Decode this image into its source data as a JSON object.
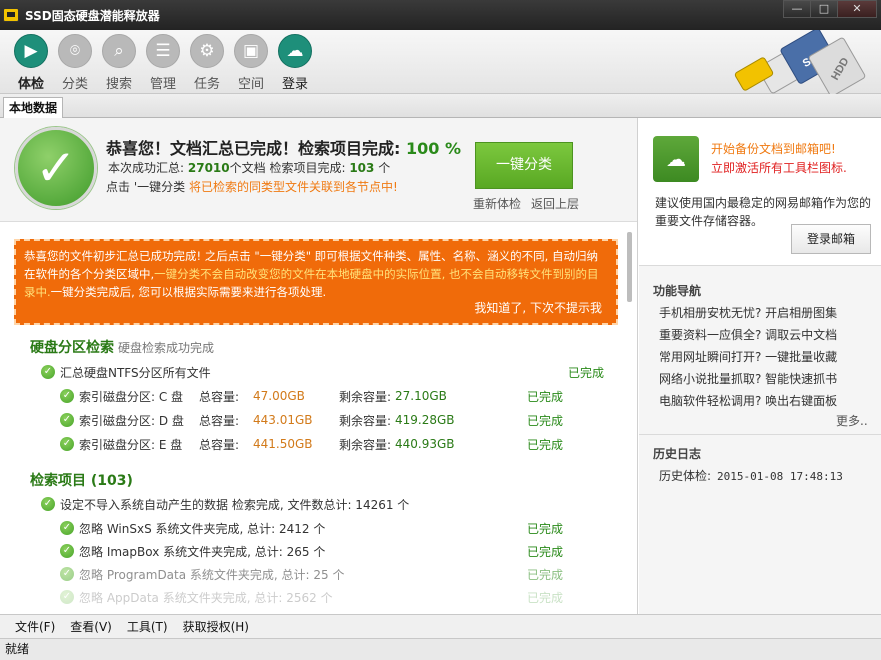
{
  "window": {
    "title": "SSD固态硬盘潜能释放器",
    "buttons": [
      "—",
      "□",
      "✕"
    ]
  },
  "toolbar": {
    "items": [
      {
        "label": "体检",
        "icon": "play-icon",
        "glyph": "▶"
      },
      {
        "label": "分类",
        "icon": "location-icon",
        "glyph": "⌾"
      },
      {
        "label": "搜索",
        "icon": "search-icon",
        "glyph": "⌕"
      },
      {
        "label": "管理",
        "icon": "list-icon",
        "glyph": "☰"
      },
      {
        "label": "任务",
        "icon": "gear-icon",
        "glyph": "⚙"
      },
      {
        "label": "空间",
        "icon": "id-card-icon",
        "glyph": "▣"
      },
      {
        "label": "登录",
        "icon": "cloud-icon",
        "glyph": "☁"
      }
    ],
    "brand": {
      "ssd_text": "SSD",
      "hdd_text": "HDD"
    }
  },
  "tabs": [
    "本地数据"
  ],
  "summary": {
    "title": "恭喜您！文档汇总已完成！检索项目完成:",
    "percent": "100 %",
    "line1_prefix": "本次成功汇总:",
    "doc_count": "27010",
    "line1_mid": "个文档  检索项目完成:",
    "item_count": "103",
    "line1_suffix": "个",
    "line2_prefix": "点击 '一键分类",
    "line2_hint": "将已检索的同类型文件关联到各节点中!",
    "classify_button": "一键分类",
    "recheck_link": "重新体检",
    "back_link": "返回上层"
  },
  "notice": {
    "text1": "恭喜您的文件初步汇总已成功完成! 之后点击 \"一键分类\" 即可根据文件种类、属性、名称、涵义的不同, 自动归纳在软件的各个分类区域中,",
    "text2": "一键分类不会自动改变您的文件在本地硬盘中的实际位置, 也不会自动移转文件到别的目录中.",
    "text3": "一键分类完成后, 您可以根据实际需要来进行各项处理.",
    "dismiss": "我知道了, 下次不提示我"
  },
  "disk_section": {
    "title": "硬盘分区检索",
    "subtitle": "硬盘检索成功完成",
    "summary_row": {
      "label": "汇总硬盘NTFS分区所有文件",
      "status": "已完成"
    },
    "partitions": [
      {
        "label": "索引磁盘分区: C 盘",
        "total_label": "总容量:",
        "total": "47.00GB",
        "free_label": "剩余容量:",
        "free": "27.10GB",
        "status": "已完成"
      },
      {
        "label": "索引磁盘分区: D 盘",
        "total_label": "总容量:",
        "total": "443.01GB",
        "free_label": "剩余容量:",
        "free": "419.28GB",
        "status": "已完成"
      },
      {
        "label": "索引磁盘分区: E 盘",
        "total_label": "总容量:",
        "total": "441.50GB",
        "free_label": "剩余容量:",
        "free": "440.93GB",
        "status": "已完成"
      }
    ]
  },
  "search_section": {
    "title": "检索项目 (103)",
    "summary_row": {
      "label": "设定不导入系统自动产生的数据 检索完成, 文件数总计: 14261 个"
    },
    "items": [
      {
        "label": "忽略 WinSxS 系统文件夹完成, 总计: 2412 个",
        "status": "已完成"
      },
      {
        "label": "忽略 ImapBox 系统文件夹完成, 总计: 265 个",
        "status": "已完成"
      },
      {
        "label": "忽略 ProgramData 系统文件夹完成, 总计: 25 个",
        "status": "已完成"
      },
      {
        "label": "忽略 AppData 系统文件夹完成, 总计: 2562 个",
        "status": "已完成"
      }
    ]
  },
  "right_panel": {
    "backup_line1": "开始备份文档到邮箱吧!",
    "backup_line2": "立即激活所有工具栏图标.",
    "backup_desc": "建议使用国内最稳定的网易邮箱作为您的重要文件存储容器。",
    "login_button": "登录邮箱",
    "nav_title": "功能导航",
    "nav_items": [
      "手机相册安枕无忧? 开启相册图集",
      "重要资料一应俱全? 调取云中文档",
      "常用网址瞬间打开? 一键批量收藏",
      "网络小说批量抓取? 智能快速抓书",
      "电脑软件轻松调用? 唤出右键面板"
    ],
    "more": "更多..",
    "history_title": "历史日志",
    "history_label": "历史体检:",
    "history_time": "2015-01-08 17:48:13"
  },
  "menubar": [
    "文件(F)",
    "查看(V)",
    "工具(T)",
    "获取授权(H)"
  ],
  "status": "就绪",
  "colors": {
    "accent_green": "#59a823",
    "notice_orange": "#f06b0a",
    "title_bar": "#2b2b2b",
    "teal": "#1e8f7a"
  }
}
